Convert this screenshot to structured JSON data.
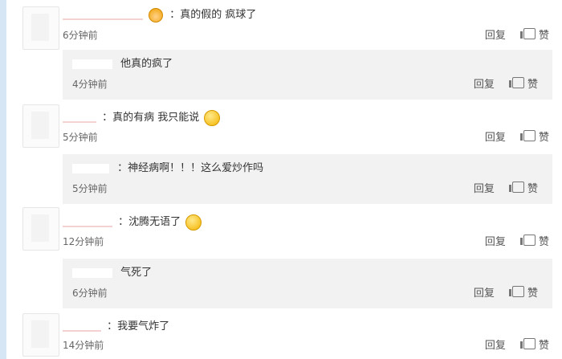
{
  "comments": [
    {
      "text": "：真的假的 疯球了",
      "time": "6分钟前",
      "reply_label": "回复",
      "like_label": "赞",
      "reply": {
        "text": "他真的疯了",
        "time": "4分钟前",
        "reply_label": "回复",
        "like_label": "赞"
      }
    },
    {
      "text": "：真的有病 我只能说",
      "time": "5分钟前",
      "reply_label": "回复",
      "like_label": "赞",
      "reply": {
        "text": "：神经病啊！！！这么爱炒作吗",
        "time": "5分钟前",
        "reply_label": "回复",
        "like_label": "赞"
      }
    },
    {
      "text": "：沈腾无语了",
      "time": "12分钟前",
      "reply_label": "回复",
      "like_label": "赞",
      "reply": {
        "text": "气死了",
        "time": "6分钟前",
        "reply_label": "回复",
        "like_label": "赞"
      }
    },
    {
      "text": "：我要气炸了",
      "time": "14分钟前",
      "reply_label": "回复",
      "like_label": "赞"
    }
  ],
  "icons": {
    "like": "thumbs-up-icon",
    "emoji": "smiley-icon"
  },
  "colors": {
    "reply_bg": "#f2f2f2",
    "text": "#333333",
    "meta": "#666666"
  }
}
